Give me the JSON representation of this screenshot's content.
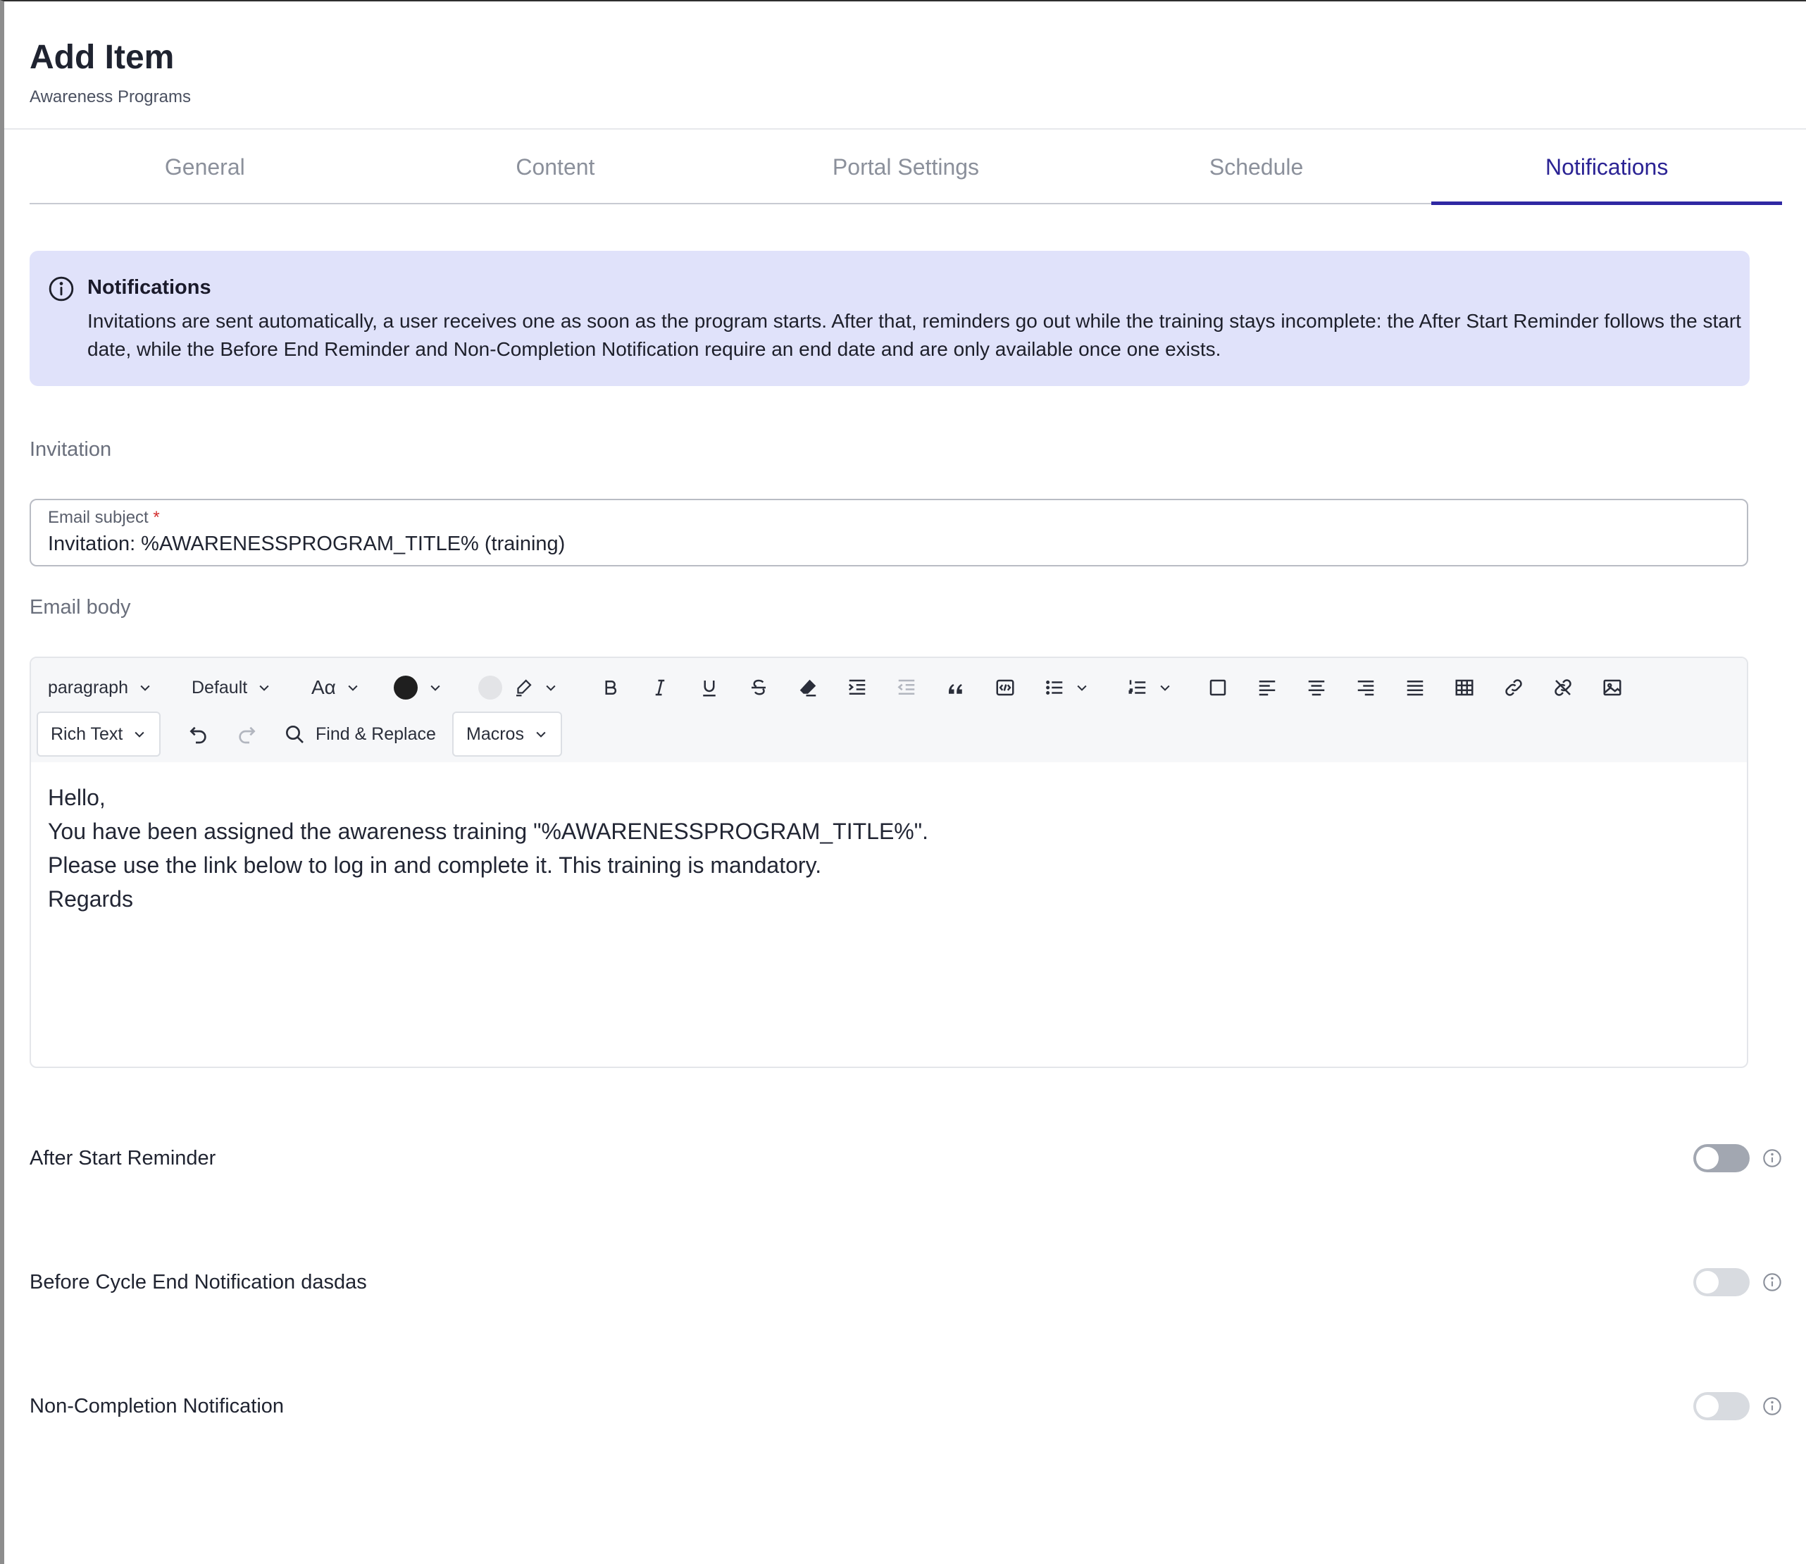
{
  "page": {
    "title": "Add Item",
    "subtitle": "Awareness Programs"
  },
  "tabs": [
    {
      "label": "General",
      "active": false
    },
    {
      "label": "Content",
      "active": false
    },
    {
      "label": "Portal Settings",
      "active": false
    },
    {
      "label": "Schedule",
      "active": false
    },
    {
      "label": "Notifications",
      "active": true
    }
  ],
  "alert": {
    "icon": "info-icon",
    "title": "Notifications",
    "text": "Invitations are sent automatically, a user receives one as soon as the program starts. After that, reminders go out while the training stays incomplete: the After Start Reminder follows the start date, while the Before End Reminder and Non-Completion Notification require an end date and are only available once one exists.",
    "background": "#e0e2fa"
  },
  "invitation": {
    "section_label": "Invitation",
    "subject_label": "Email subject",
    "required_mark": "*",
    "subject_value": "Invitation: %AWARENESSPROGRAM_TITLE% (training)",
    "body_label": "Email body"
  },
  "toolbar": {
    "block_format": "paragraph",
    "font_family": "Default",
    "font_size_icon": "Aα",
    "text_color": "#1f1f1f",
    "highlight_color": "#e3e4e7",
    "mode_select": "Rich Text",
    "find_replace": "Find & Replace",
    "macros": "Macros"
  },
  "editor_body": {
    "lines": [
      "Hello,",
      "You have been assigned the awareness training \"%AWARENESSPROGRAM_TITLE%\".",
      "Please use the link below to log in and complete it. This training is mandatory.",
      "Regards"
    ]
  },
  "toggles": [
    {
      "label": "After Start Reminder",
      "on": false,
      "enabled": true
    },
    {
      "label": "Before Cycle End Notification dasdas",
      "on": false,
      "enabled": false
    },
    {
      "label": "Non-Completion Notification",
      "on": false,
      "enabled": false
    }
  ],
  "colors": {
    "accent": "#2f28a3",
    "tab_inactive": "#8b909b"
  }
}
